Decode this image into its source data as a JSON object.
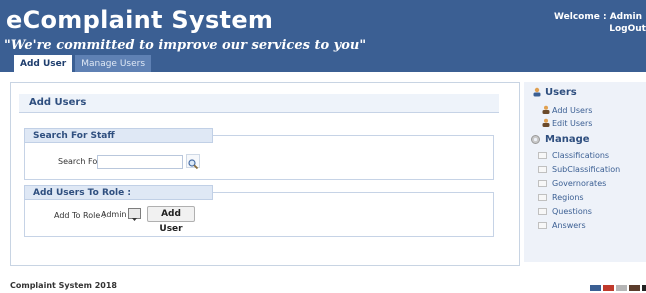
{
  "app": {
    "title": "eComplaint System",
    "tagline": "\"We're committed to improve our services to you\""
  },
  "user": {
    "welcome": "Welcome : Admin",
    "logout": "LogOut"
  },
  "tabs": [
    {
      "label": "Add User",
      "active": true
    },
    {
      "label": "Manage Users",
      "active": false
    }
  ],
  "main": {
    "heading": "Add Users",
    "search_section": {
      "legend": "Search For Staff",
      "label": "Search For :",
      "value": ""
    },
    "role_section": {
      "legend": "Add Users To Role :",
      "label": "Add To Role :",
      "selected": "Admin",
      "button": "Add User"
    }
  },
  "sidebar": {
    "users_heading": "Users",
    "users_items": [
      "Add Users",
      "Edit Users"
    ],
    "manage_heading": "Manage",
    "manage_items": [
      "Classifications",
      "SubClassification",
      "Governorates",
      "Regions",
      "Questions",
      "Answers"
    ]
  },
  "footer": {
    "text": "Complaint System  2018",
    "theme_colors": [
      "#3b5f93",
      "#c0392b",
      "#b5b5b5",
      "#5b3c2c",
      "#222222"
    ]
  },
  "colors": {
    "header": "#3b5f93",
    "link": "#3b5f93"
  }
}
